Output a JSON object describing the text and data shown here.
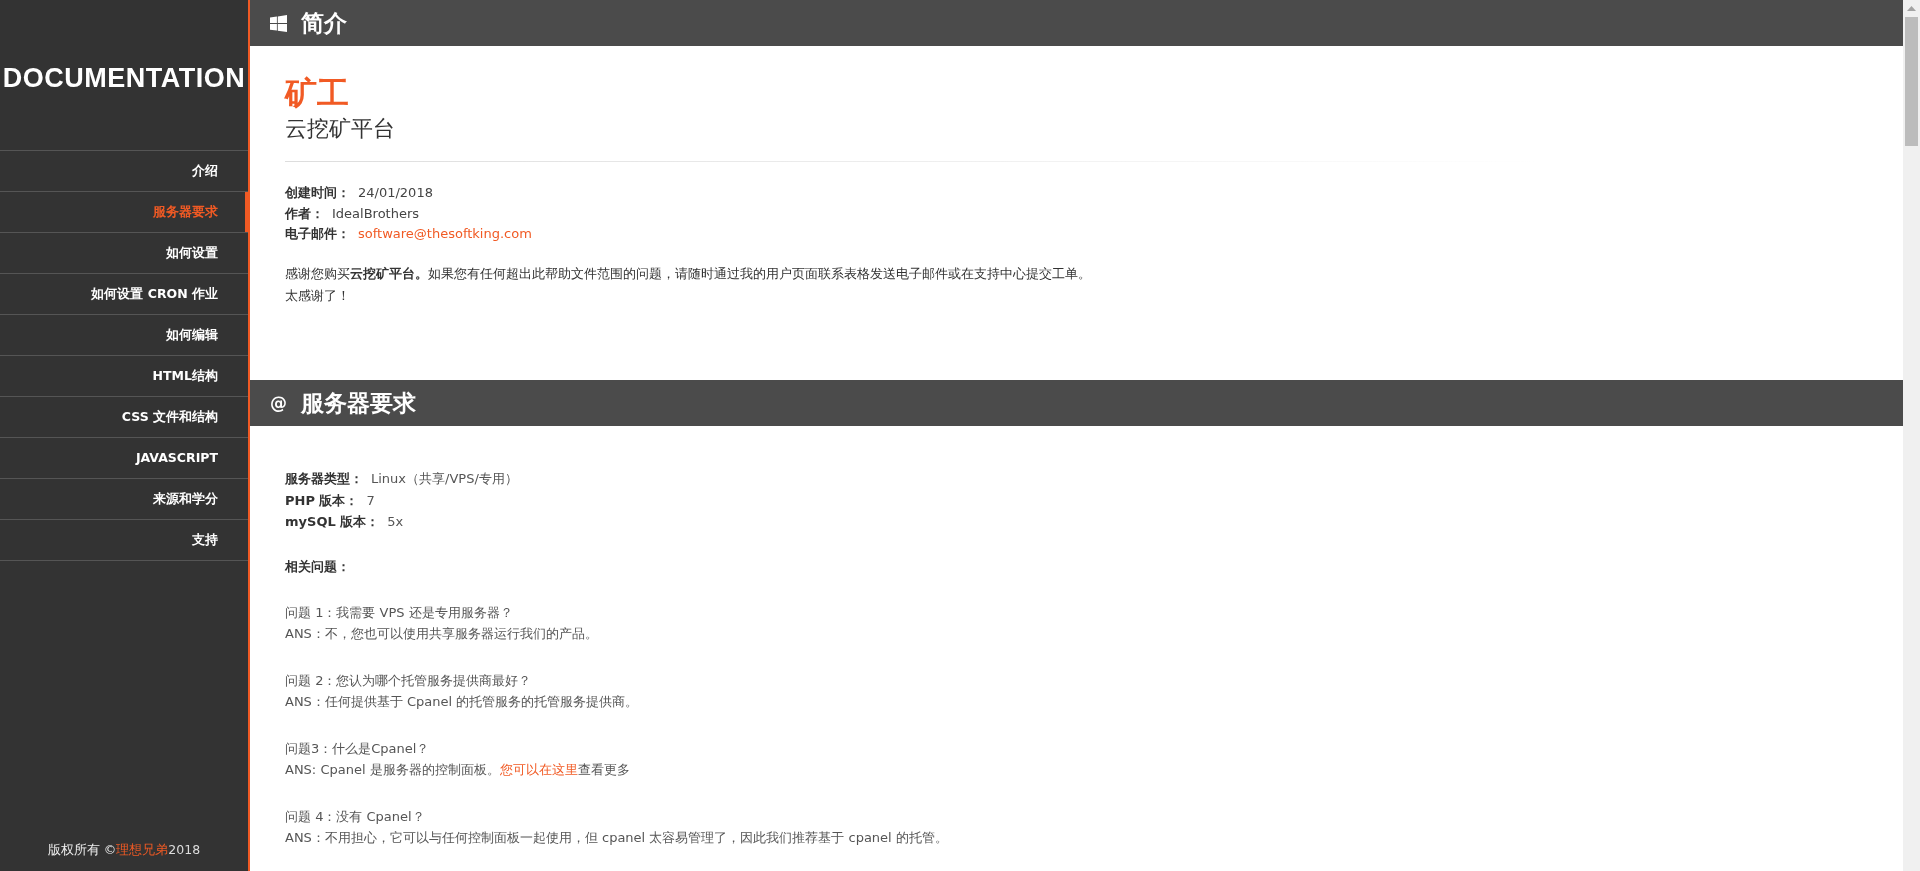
{
  "sidebar": {
    "logo": "DOCUMENTATION",
    "items": [
      {
        "label": "介绍",
        "selected": false
      },
      {
        "label": "服务器要求",
        "selected": true
      },
      {
        "label": "如何设置",
        "selected": false
      },
      {
        "label": "如何设置 CRON 作业",
        "selected": false
      },
      {
        "label": "如何编辑",
        "selected": false
      },
      {
        "label": "HTML结构",
        "selected": false
      },
      {
        "label": "CSS 文件和结构",
        "selected": false
      },
      {
        "label": "JAVASCRIPT",
        "selected": false
      },
      {
        "label": "来源和学分",
        "selected": false
      },
      {
        "label": "支持",
        "selected": false
      }
    ],
    "footer": {
      "prefix": "版权所有 ©",
      "link": "理想兄弟",
      "suffix": "2018"
    }
  },
  "intro": {
    "heading": "简介",
    "icon": {
      "kind": "windows"
    },
    "title": "矿工",
    "subtitle": "云挖矿平台",
    "meta": [
      {
        "label": "创建时间：",
        "value": "24/01/2018",
        "kind": "text"
      },
      {
        "label": "作者：",
        "value": "IdealBrothers",
        "kind": "text"
      },
      {
        "label": "电子邮件：",
        "value": "software@thesoftking.com",
        "kind": "link"
      }
    ],
    "paragraphs": [
      "感谢您购买**云挖矿平台。**如果您有任何超出此帮助文件范围的问题，请随时通过我的用户页面联系表格发送电子邮件或在支持中心提交工单。",
      "太感谢了！"
    ]
  },
  "requirements": {
    "heading": "服务器要求",
    "icon": {
      "kind": "glyph",
      "text": "@"
    },
    "specs": [
      {
        "label": "服务器类型：",
        "value": "Linux（共享/VPS/专用）"
      },
      {
        "label": "PHP 版本：",
        "value": "7"
      },
      {
        "label": "mySQL 版本：",
        "value": "5x"
      }
    ],
    "related_heading": "相关问题：",
    "qa": [
      {
        "question": "问题 1：我需要 VPS 还是专用服务器？",
        "answer": [
          {
            "kind": "text",
            "text": "ANS：不，您也可以使用共享服务器运行我们的产品。"
          }
        ]
      },
      {
        "question": "问题 2：您认为哪个托管服务提供商最好？",
        "answer": [
          {
            "kind": "text",
            "text": "ANS：任何提供基于 Cpanel 的托管服务的托管服务提供商。"
          }
        ]
      },
      {
        "question": "问题3：什么是Cpanel？",
        "answer": [
          {
            "kind": "text",
            "text": "ANS: Cpanel 是服务器的控制面板。"
          },
          {
            "kind": "link",
            "text": "您可以在这里"
          },
          {
            "kind": "text",
            "text": "查看更多"
          }
        ]
      },
      {
        "question": "问题 4：没有 Cpanel？",
        "answer": [
          {
            "kind": "text",
            "text": "ANS：不用担心，它可以与任何控制面板一起使用，但 cpanel 太容易管理了，因此我们推荐基于 cpanel 的托管。"
          }
        ]
      }
    ]
  }
}
